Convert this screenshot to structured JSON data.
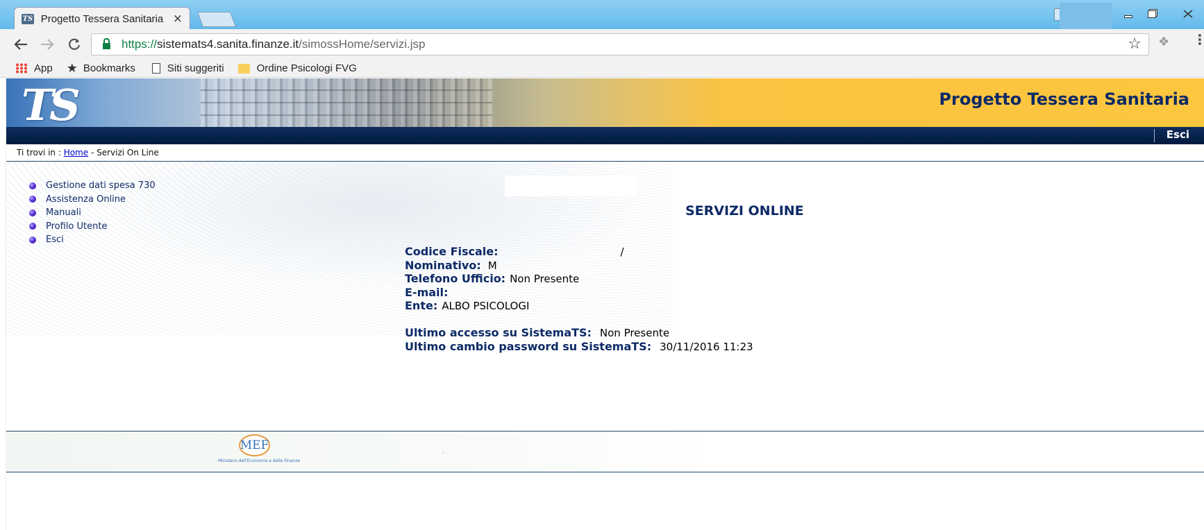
{
  "browser": {
    "tab_title": "Progetto Tessera Sanitaria",
    "tab_close": "×",
    "url_scheme": "https://",
    "url_host": "sistemats4.sanita.finanze.it",
    "url_path": "/simossHome/servizi.jsp",
    "bookmarks": [
      {
        "label": "App",
        "icon": "apps-icon"
      },
      {
        "label": "Bookmarks",
        "icon": "star-icon"
      },
      {
        "label": "Siti suggeriti",
        "icon": "page-icon"
      },
      {
        "label": "Ordine Psicologi FVG",
        "icon": "folder-icon"
      }
    ],
    "accent_colors": {
      "secure_green": "#0b8043",
      "tab_bar": "#62b9ea"
    }
  },
  "site": {
    "logo_text": "TS",
    "title": "Progetto Tessera Sanitaria",
    "nav_esci": "Esci",
    "colors": {
      "navy": "#0d2a66",
      "banner_gold": "#fcc63f",
      "navbar": "#001a3f"
    }
  },
  "breadcrumb": {
    "prefix": "Ti trovi in : ",
    "home": "Home",
    "current": " - Servizi On Line"
  },
  "sidebar": {
    "items": [
      {
        "label": "Gestione dati spesa 730"
      },
      {
        "label": "Assistenza Online"
      },
      {
        "label": "Manuali"
      },
      {
        "label": "Profilo Utente"
      },
      {
        "label": "Esci"
      }
    ]
  },
  "main": {
    "title": "SERVIZI ONLINE",
    "fields": {
      "codice_fiscale": {
        "label": "Codice Fiscale:",
        "value": "",
        "tail": "/"
      },
      "nominativo": {
        "label": "Nominativo:",
        "value": "M"
      },
      "telefono": {
        "label": "Telefono Ufficio:",
        "value": "Non Presente"
      },
      "email": {
        "label": "E-mail:",
        "value": ""
      },
      "ente": {
        "label": "Ente:",
        "value": "ALBO PSICOLOGI"
      },
      "ultimo_accesso": {
        "label": "Ultimo accesso su SistemaTS:",
        "value": "Non Presente"
      },
      "ultimo_cambio": {
        "label": "Ultimo cambio password su SistemaTS:",
        "value": "30/11/2016 11:23"
      }
    }
  },
  "footer": {
    "logo_text": "MEF",
    "caption": "Ministero dell'Economia e delle Finanze",
    "dot": "."
  }
}
